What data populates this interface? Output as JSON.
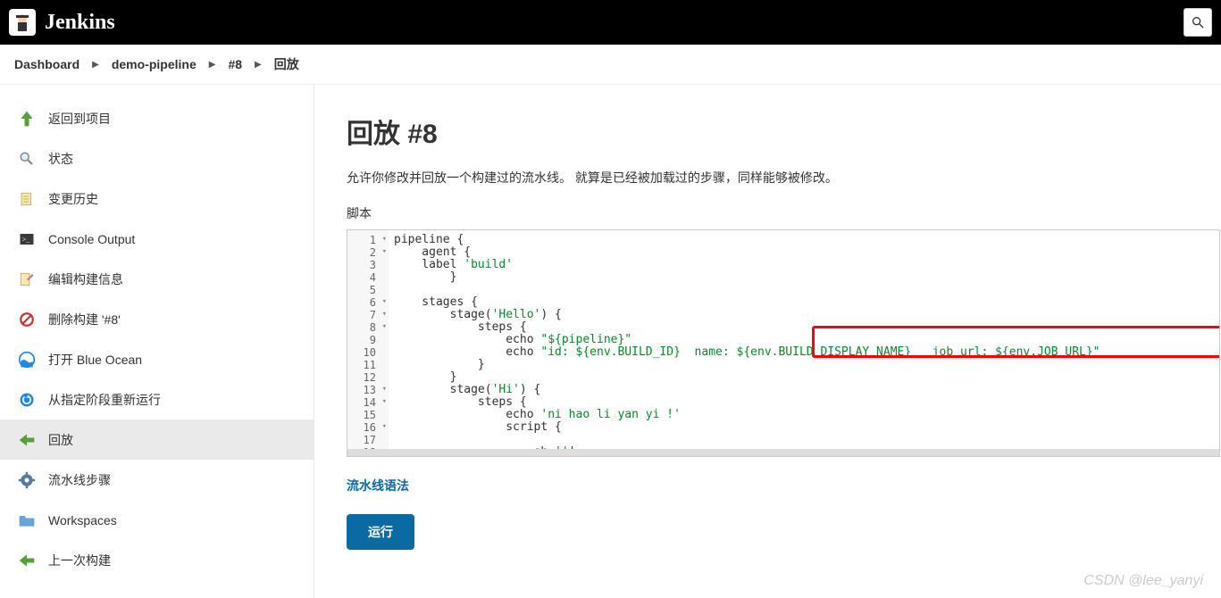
{
  "header": {
    "brand": "Jenkins"
  },
  "breadcrumb": [
    {
      "label": "Dashboard"
    },
    {
      "label": "demo-pipeline"
    },
    {
      "label": "#8"
    },
    {
      "label": "回放"
    }
  ],
  "sidebar": {
    "items": [
      {
        "label": "返回到项目",
        "icon": "arrow-up-green"
      },
      {
        "label": "状态",
        "icon": "magnifier"
      },
      {
        "label": "变更历史",
        "icon": "notepad"
      },
      {
        "label": "Console Output",
        "icon": "terminal"
      },
      {
        "label": "编辑构建信息",
        "icon": "notepad-pencil"
      },
      {
        "label": "删除构建 '#8'",
        "icon": "forbidden"
      },
      {
        "label": "打开 Blue Ocean",
        "icon": "blueocean"
      },
      {
        "label": "从指定阶段重新运行",
        "icon": "rerun"
      },
      {
        "label": "回放",
        "icon": "arrow-left-green",
        "active": true
      },
      {
        "label": "流水线步骤",
        "icon": "gear-blue"
      },
      {
        "label": "Workspaces",
        "icon": "folder"
      },
      {
        "label": "上一次构建",
        "icon": "arrow-left-green"
      }
    ]
  },
  "page": {
    "title": "回放 #8",
    "description": "允许你修改并回放一个构建过的流水线。 就算是已经被加载过的步骤，同样能够被修改。",
    "script_label": "脚本",
    "syntax_link": "流水线语法",
    "run_button": "运行"
  },
  "editor": {
    "lines": [
      "pipeline {",
      "    agent {",
      "    label 'build'",
      "        }",
      "",
      "    stages {",
      "        stage('Hello') {",
      "            steps {",
      "                echo \"${pipeline}\"",
      "                echo \"id: ${env.BUILD_ID}  name: ${env.BUILD_DISPLAY_NAME}   job_url: ${env.JOB_URL}\"",
      "            }",
      "        }",
      "        stage('Hi') {",
      "            steps {",
      "                echo 'ni hao li yan yi !'",
      "                script {",
      "",
      "                    sh '''"
    ],
    "folds": [
      1,
      2,
      6,
      7,
      8,
      13,
      14,
      16
    ]
  },
  "watermark": "CSDN @lee_yanyi"
}
